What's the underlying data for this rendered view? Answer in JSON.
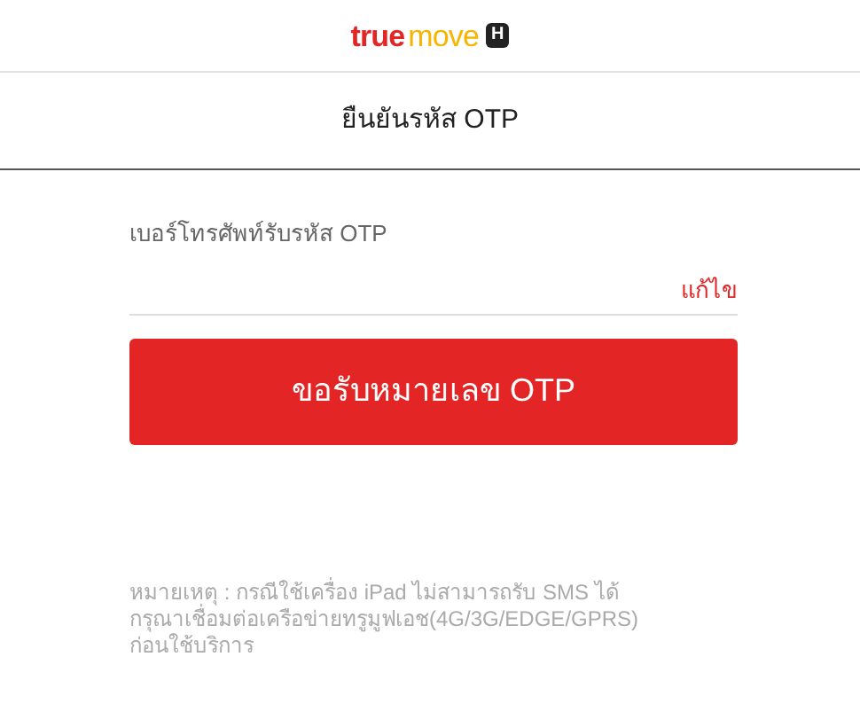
{
  "logo": {
    "brand_part_1": "true",
    "brand_part_2": "move",
    "badge": "H"
  },
  "title": "ยืนยันรหัส OTP",
  "phone_field": {
    "label": "เบอร์โทรศัพท์รับรหัส OTP",
    "action_link": "แก้ไข"
  },
  "submit_button": "ขอรับหมายเลข OTP",
  "note_lines": [
    "หมายเหตุ : กรณีใช้เครื่อง iPad ไม่สามารถรับ SMS ได้",
    "กรุณาเชื่อมต่อเครือข่ายทรูมูฟเอช(4G/3G/EDGE/GPRS)",
    "ก่อนใช้บริการ"
  ]
}
